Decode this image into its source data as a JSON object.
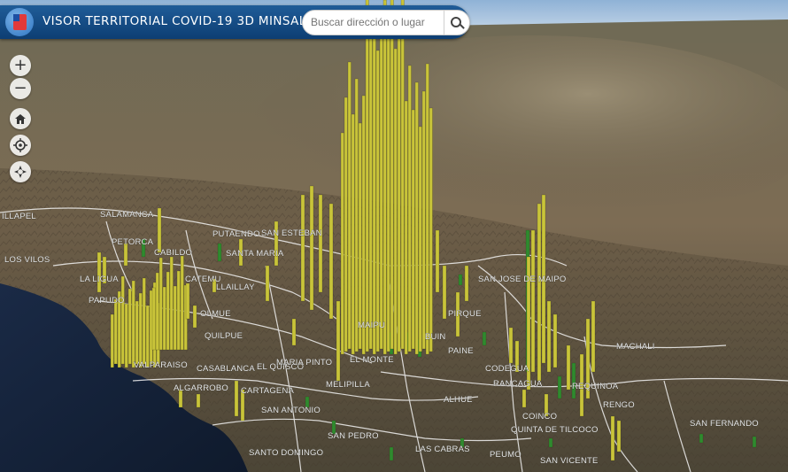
{
  "header": {
    "title": "VISOR TERRITORIAL COVID-19 3D MINSAL"
  },
  "search": {
    "placeholder": "Buscar dirección o lugar"
  },
  "nav_controls": [
    {
      "name": "zoom-in-button",
      "icon": "plus-icon",
      "glyph": "+"
    },
    {
      "name": "zoom-out-button",
      "icon": "minus-icon",
      "glyph": "−"
    },
    {
      "name": "home-button",
      "icon": "home-icon",
      "glyph": ""
    },
    {
      "name": "locate-button",
      "icon": "locate-icon",
      "glyph": ""
    },
    {
      "name": "compass-button",
      "icon": "compass-icon",
      "glyph": ""
    }
  ],
  "places": [
    "ILLAPEL",
    "SALAMANCA",
    "PETORCA",
    "LOS VILOS",
    "CABILDO",
    "PUTAENDO",
    "SAN ESTEBAN",
    "SANTA MARIA",
    "LA LIGUA",
    "PAPUDO",
    "CATEMU",
    "LLAILLAY",
    "OLMUE",
    "QUILPUE",
    "VALPARAISO",
    "CASABLANCA",
    "EL QUISCO",
    "ALGARROBO",
    "CARTAGENA",
    "SAN ANTONIO",
    "MARIA PINTO",
    "MELIPILLA",
    "EL MONTE",
    "MAIPU",
    "PIRQUE",
    "BUIN",
    "PAINE",
    "SAN JOSE DE MAIPO",
    "CODEGUA",
    "RANCAGUA",
    "REQUINOA",
    "COINCO",
    "QUINTA DE TILCOCO",
    "RENGO",
    "MACHALI",
    "SAN FERNANDO",
    "SAN PEDRO",
    "ALHUE",
    "LAS CABRAS",
    "SANTO DOMINGO",
    "PEUMO",
    "SAN VICENTE"
  ],
  "colors": {
    "header": "#0d3e73",
    "bars_yellow": "#c9c43a",
    "bars_green": "#2f8a2f",
    "ocean": "#17233a",
    "terrain": "#6e5e48",
    "sky": "#c7d6e6",
    "borders": "#f2f2f2"
  }
}
